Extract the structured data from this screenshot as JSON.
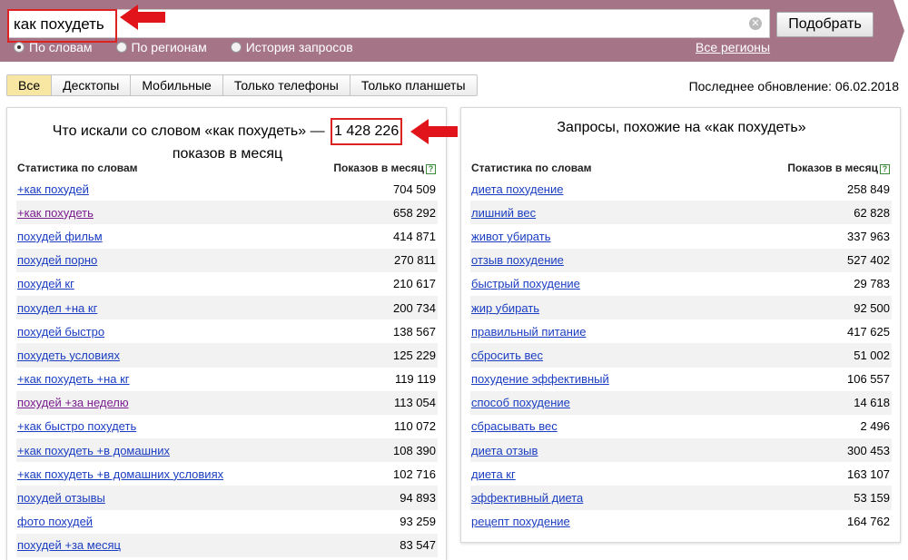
{
  "search": {
    "value": "как похудеть",
    "submit_label": "Подобрать"
  },
  "modes": [
    {
      "label": "По словам",
      "selected": true
    },
    {
      "label": "По регионам",
      "selected": false
    },
    {
      "label": "История запросов",
      "selected": false
    }
  ],
  "regions_link": "Все регионы",
  "tabs": [
    "Все",
    "Десктопы",
    "Мобильные",
    "Только телефоны",
    "Только планшеты"
  ],
  "active_tab": "Все",
  "last_update": "Последнее обновление: 06.02.2018",
  "left_panel": {
    "title_prefix": "Что искали со словом «как похудеть» —",
    "total": "1 428 226",
    "title_suffix": "показов в месяц",
    "col_keyword": "Статистика по словам",
    "col_count": "Показов в месяц",
    "rows": [
      {
        "kw": "+как похудей",
        "count": "704 509"
      },
      {
        "kw": "+как похудеть",
        "count": "658 292"
      },
      {
        "kw": "похудей фильм",
        "count": "414 871"
      },
      {
        "kw": "похудей порно",
        "count": "270 811"
      },
      {
        "kw": "похудей кг",
        "count": "210 617"
      },
      {
        "kw": "похудел +на кг",
        "count": "200 734"
      },
      {
        "kw": "похудей быстро",
        "count": "138 567"
      },
      {
        "kw": "похудеть условиях",
        "count": "125 229"
      },
      {
        "kw": "+как похудеть +на кг",
        "count": "119 119"
      },
      {
        "kw": "похудей +за неделю",
        "count": "113 054"
      },
      {
        "kw": "+как быстро похудеть",
        "count": "110 072"
      },
      {
        "kw": "+как похудеть +в домашних",
        "count": "108 390"
      },
      {
        "kw": "+как похудеть +в домашних условиях",
        "count": "102 716"
      },
      {
        "kw": "похудей отзывы",
        "count": "94 893"
      },
      {
        "kw": "фото похудей",
        "count": "93 259"
      },
      {
        "kw": "похудей +за месяц",
        "count": "83 547"
      }
    ]
  },
  "right_panel": {
    "title": "Запросы, похожие на «как похудеть»",
    "col_keyword": "Статистика по словам",
    "col_count": "Показов в месяц",
    "rows": [
      {
        "kw": "диета похудение",
        "count": "258 849"
      },
      {
        "kw": "лишний вес",
        "count": "62 828"
      },
      {
        "kw": "живот убирать",
        "count": "337 963"
      },
      {
        "kw": "отзыв похудение",
        "count": "527 402"
      },
      {
        "kw": "быстрый похудение",
        "count": "29 783"
      },
      {
        "kw": "жир убирать",
        "count": "92 500"
      },
      {
        "kw": "правильный питание",
        "count": "417 625"
      },
      {
        "kw": "сбросить вес",
        "count": "51 002"
      },
      {
        "kw": "похудение эффективный",
        "count": "106 557"
      },
      {
        "kw": "способ похудение",
        "count": "14 618"
      },
      {
        "kw": "сбрасывать вес",
        "count": "2 496"
      },
      {
        "kw": "диета отзыв",
        "count": "300 453"
      },
      {
        "kw": "диета кг",
        "count": "163 107"
      },
      {
        "kw": "эффективный диета",
        "count": "53 159"
      },
      {
        "kw": "рецепт похудение",
        "count": "164 762"
      }
    ]
  },
  "colors": {
    "header_band": "#a57587",
    "link": "#1a3dc1",
    "visited": "#7a1d8f",
    "highlight": "#dd2222"
  }
}
